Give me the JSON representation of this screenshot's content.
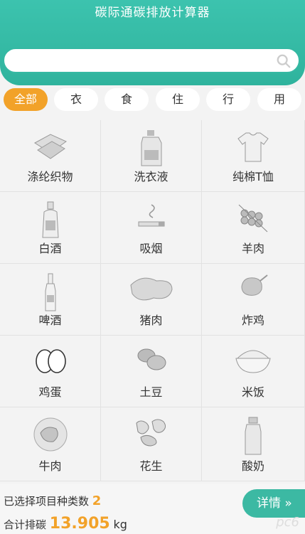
{
  "header": {
    "title": "碳际通碳排放计算器"
  },
  "search": {
    "placeholder": ""
  },
  "tabs": [
    {
      "label": "全部"
    },
    {
      "label": "衣"
    },
    {
      "label": "食"
    },
    {
      "label": "住"
    },
    {
      "label": "行"
    },
    {
      "label": "用"
    }
  ],
  "items": [
    {
      "label": "涤纶织物",
      "icon": "fabric-icon"
    },
    {
      "label": "洗衣液",
      "icon": "detergent-icon"
    },
    {
      "label": "纯棉T恤",
      "icon": "tshirt-icon"
    },
    {
      "label": "白酒",
      "icon": "liquor-bottle-icon"
    },
    {
      "label": "吸烟",
      "icon": "cigarette-icon"
    },
    {
      "label": "羊肉",
      "icon": "kebab-icon"
    },
    {
      "label": "啤酒",
      "icon": "beer-bottle-icon"
    },
    {
      "label": "猪肉",
      "icon": "pork-icon"
    },
    {
      "label": "炸鸡",
      "icon": "fried-chicken-icon"
    },
    {
      "label": "鸡蛋",
      "icon": "egg-icon"
    },
    {
      "label": "土豆",
      "icon": "potato-icon"
    },
    {
      "label": "米饭",
      "icon": "rice-bowl-icon"
    },
    {
      "label": "牛肉",
      "icon": "beef-icon"
    },
    {
      "label": "花生",
      "icon": "peanut-icon"
    },
    {
      "label": "酸奶",
      "icon": "yogurt-icon"
    }
  ],
  "footer": {
    "selected_label": "已选择项目种类数",
    "selected_count": "2",
    "total_label": "合计排碳",
    "total_value": "13.905",
    "unit": "kg",
    "details_label": "详情 »",
    "watermark": "pc6"
  },
  "colors": {
    "accent": "#3cc3ae",
    "orange": "#f2a229"
  }
}
